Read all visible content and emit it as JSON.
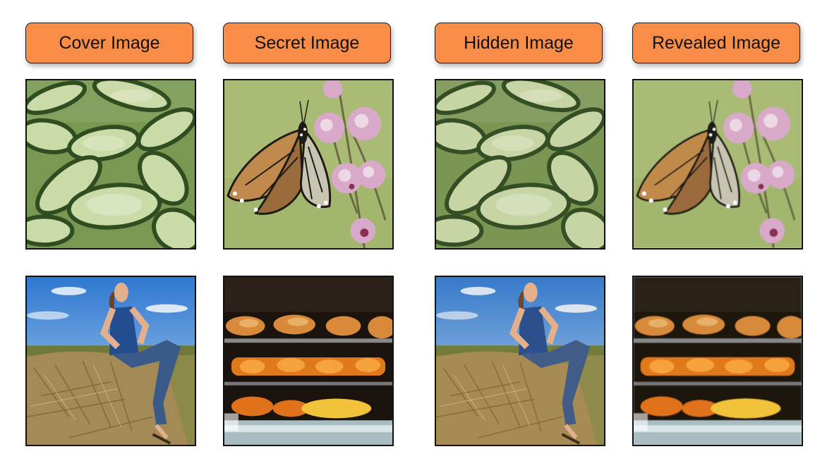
{
  "column_labels": {
    "cover": "Cover Image",
    "secret": "Secret Image",
    "hidden": "Hidden Image",
    "revealed": "Revealed Image"
  },
  "rows": [
    {
      "cover": "cucumber-slices-photo",
      "secret": "monarch-butterfly-on-pink-flower-photo",
      "hidden": "cucumber-slices-photo",
      "revealed": "monarch-butterfly-on-pink-flower-photo"
    },
    {
      "cover": "woman-sitting-on-hay-bale-photo",
      "secret": "rotisserie-chicken-photo",
      "hidden": "woman-sitting-on-hay-bale-photo",
      "revealed": "rotisserie-chicken-photo"
    }
  ],
  "colors": {
    "label_fill": "#f98d48",
    "label_border": "#1a1a1a"
  }
}
